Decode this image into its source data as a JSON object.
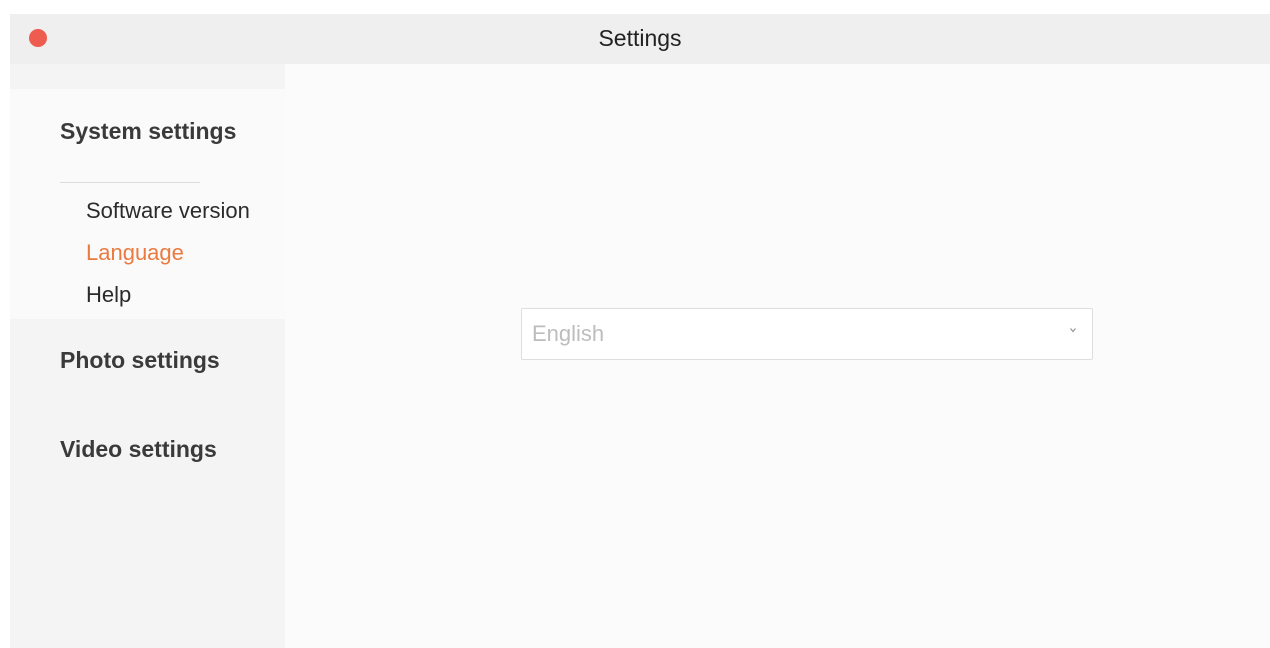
{
  "window": {
    "title": "Settings",
    "close_color": "#ee5b4f"
  },
  "sidebar": {
    "sections": [
      {
        "title": "System settings",
        "items": [
          {
            "label": "Software version",
            "active": false
          },
          {
            "label": "Language",
            "active": true
          },
          {
            "label": "Help",
            "active": false
          }
        ]
      },
      {
        "title": "Photo settings"
      },
      {
        "title": "Video settings"
      }
    ],
    "active_color": "#ea7a3f"
  },
  "language": {
    "selected": "English",
    "icon": "chevron-down-icon"
  }
}
